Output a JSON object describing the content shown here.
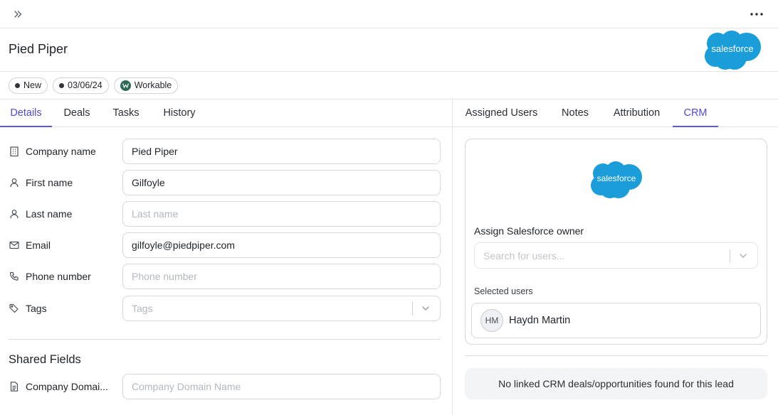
{
  "app": {
    "title": "Pied Piper",
    "crm_brand": "salesforce",
    "accent_color": "#5b57e0",
    "salesforce_color": "#1a9dd9"
  },
  "topbar": {
    "expand_icon": "chevrons-right-icon",
    "more_icon": "more-horizontal-icon"
  },
  "badges": [
    {
      "label": "New",
      "icon": "dot"
    },
    {
      "label": "03/06/24",
      "icon": "dot"
    },
    {
      "label": "Workable",
      "icon": "workable-logo"
    }
  ],
  "left_tabs": [
    {
      "label": "Details",
      "active": true
    },
    {
      "label": "Deals",
      "active": false
    },
    {
      "label": "Tasks",
      "active": false
    },
    {
      "label": "History",
      "active": false
    }
  ],
  "fields": {
    "company_name": {
      "label": "Company name",
      "value": "Pied Piper",
      "placeholder": "",
      "icon": "building-icon"
    },
    "first_name": {
      "label": "First name",
      "value": "Gilfoyle",
      "placeholder": "",
      "icon": "user-icon"
    },
    "last_name": {
      "label": "Last name",
      "value": "",
      "placeholder": "Last name",
      "icon": "user-icon"
    },
    "email": {
      "label": "Email",
      "value": "gilfoyle@piedpiper.com",
      "placeholder": "",
      "icon": "mail-icon"
    },
    "phone": {
      "label": "Phone number",
      "value": "",
      "placeholder": "Phone number",
      "icon": "phone-icon"
    },
    "tags": {
      "label": "Tags",
      "value": "",
      "placeholder": "Tags",
      "icon": "tag-icon"
    }
  },
  "shared_fields": {
    "title": "Shared Fields",
    "company_domain": {
      "label": "Company Domai...",
      "value": "",
      "placeholder": "Company Domain Name",
      "icon": "document-icon"
    }
  },
  "right_tabs": [
    {
      "label": "Assigned Users",
      "active": false
    },
    {
      "label": "Notes",
      "active": false
    },
    {
      "label": "Attribution",
      "active": false
    },
    {
      "label": "CRM",
      "active": true
    }
  ],
  "crm": {
    "assign_label": "Assign Salesforce owner",
    "search_placeholder": "Search for users...",
    "selected_label": "Selected users",
    "selected_user": {
      "initials": "HM",
      "name": "Haydn Martin"
    },
    "empty_message": "No linked CRM deals/opportunities found for this lead"
  }
}
